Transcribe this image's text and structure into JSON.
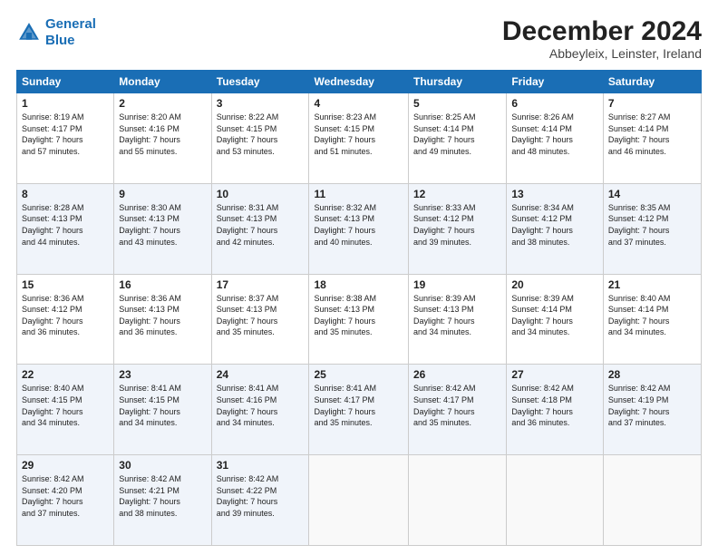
{
  "logo": {
    "line1": "General",
    "line2": "Blue"
  },
  "title": "December 2024",
  "location": "Abbeyleix, Leinster, Ireland",
  "days_of_week": [
    "Sunday",
    "Monday",
    "Tuesday",
    "Wednesday",
    "Thursday",
    "Friday",
    "Saturday"
  ],
  "weeks": [
    [
      {
        "day": "1",
        "info": "Sunrise: 8:19 AM\nSunset: 4:17 PM\nDaylight: 7 hours\nand 57 minutes."
      },
      {
        "day": "2",
        "info": "Sunrise: 8:20 AM\nSunset: 4:16 PM\nDaylight: 7 hours\nand 55 minutes."
      },
      {
        "day": "3",
        "info": "Sunrise: 8:22 AM\nSunset: 4:15 PM\nDaylight: 7 hours\nand 53 minutes."
      },
      {
        "day": "4",
        "info": "Sunrise: 8:23 AM\nSunset: 4:15 PM\nDaylight: 7 hours\nand 51 minutes."
      },
      {
        "day": "5",
        "info": "Sunrise: 8:25 AM\nSunset: 4:14 PM\nDaylight: 7 hours\nand 49 minutes."
      },
      {
        "day": "6",
        "info": "Sunrise: 8:26 AM\nSunset: 4:14 PM\nDaylight: 7 hours\nand 48 minutes."
      },
      {
        "day": "7",
        "info": "Sunrise: 8:27 AM\nSunset: 4:14 PM\nDaylight: 7 hours\nand 46 minutes."
      }
    ],
    [
      {
        "day": "8",
        "info": "Sunrise: 8:28 AM\nSunset: 4:13 PM\nDaylight: 7 hours\nand 44 minutes."
      },
      {
        "day": "9",
        "info": "Sunrise: 8:30 AM\nSunset: 4:13 PM\nDaylight: 7 hours\nand 43 minutes."
      },
      {
        "day": "10",
        "info": "Sunrise: 8:31 AM\nSunset: 4:13 PM\nDaylight: 7 hours\nand 42 minutes."
      },
      {
        "day": "11",
        "info": "Sunrise: 8:32 AM\nSunset: 4:13 PM\nDaylight: 7 hours\nand 40 minutes."
      },
      {
        "day": "12",
        "info": "Sunrise: 8:33 AM\nSunset: 4:12 PM\nDaylight: 7 hours\nand 39 minutes."
      },
      {
        "day": "13",
        "info": "Sunrise: 8:34 AM\nSunset: 4:12 PM\nDaylight: 7 hours\nand 38 minutes."
      },
      {
        "day": "14",
        "info": "Sunrise: 8:35 AM\nSunset: 4:12 PM\nDaylight: 7 hours\nand 37 minutes."
      }
    ],
    [
      {
        "day": "15",
        "info": "Sunrise: 8:36 AM\nSunset: 4:12 PM\nDaylight: 7 hours\nand 36 minutes."
      },
      {
        "day": "16",
        "info": "Sunrise: 8:36 AM\nSunset: 4:13 PM\nDaylight: 7 hours\nand 36 minutes."
      },
      {
        "day": "17",
        "info": "Sunrise: 8:37 AM\nSunset: 4:13 PM\nDaylight: 7 hours\nand 35 minutes."
      },
      {
        "day": "18",
        "info": "Sunrise: 8:38 AM\nSunset: 4:13 PM\nDaylight: 7 hours\nand 35 minutes."
      },
      {
        "day": "19",
        "info": "Sunrise: 8:39 AM\nSunset: 4:13 PM\nDaylight: 7 hours\nand 34 minutes."
      },
      {
        "day": "20",
        "info": "Sunrise: 8:39 AM\nSunset: 4:14 PM\nDaylight: 7 hours\nand 34 minutes."
      },
      {
        "day": "21",
        "info": "Sunrise: 8:40 AM\nSunset: 4:14 PM\nDaylight: 7 hours\nand 34 minutes."
      }
    ],
    [
      {
        "day": "22",
        "info": "Sunrise: 8:40 AM\nSunset: 4:15 PM\nDaylight: 7 hours\nand 34 minutes."
      },
      {
        "day": "23",
        "info": "Sunrise: 8:41 AM\nSunset: 4:15 PM\nDaylight: 7 hours\nand 34 minutes."
      },
      {
        "day": "24",
        "info": "Sunrise: 8:41 AM\nSunset: 4:16 PM\nDaylight: 7 hours\nand 34 minutes."
      },
      {
        "day": "25",
        "info": "Sunrise: 8:41 AM\nSunset: 4:17 PM\nDaylight: 7 hours\nand 35 minutes."
      },
      {
        "day": "26",
        "info": "Sunrise: 8:42 AM\nSunset: 4:17 PM\nDaylight: 7 hours\nand 35 minutes."
      },
      {
        "day": "27",
        "info": "Sunrise: 8:42 AM\nSunset: 4:18 PM\nDaylight: 7 hours\nand 36 minutes."
      },
      {
        "day": "28",
        "info": "Sunrise: 8:42 AM\nSunset: 4:19 PM\nDaylight: 7 hours\nand 37 minutes."
      }
    ],
    [
      {
        "day": "29",
        "info": "Sunrise: 8:42 AM\nSunset: 4:20 PM\nDaylight: 7 hours\nand 37 minutes."
      },
      {
        "day": "30",
        "info": "Sunrise: 8:42 AM\nSunset: 4:21 PM\nDaylight: 7 hours\nand 38 minutes."
      },
      {
        "day": "31",
        "info": "Sunrise: 8:42 AM\nSunset: 4:22 PM\nDaylight: 7 hours\nand 39 minutes."
      },
      {
        "day": "",
        "info": ""
      },
      {
        "day": "",
        "info": ""
      },
      {
        "day": "",
        "info": ""
      },
      {
        "day": "",
        "info": ""
      }
    ]
  ]
}
